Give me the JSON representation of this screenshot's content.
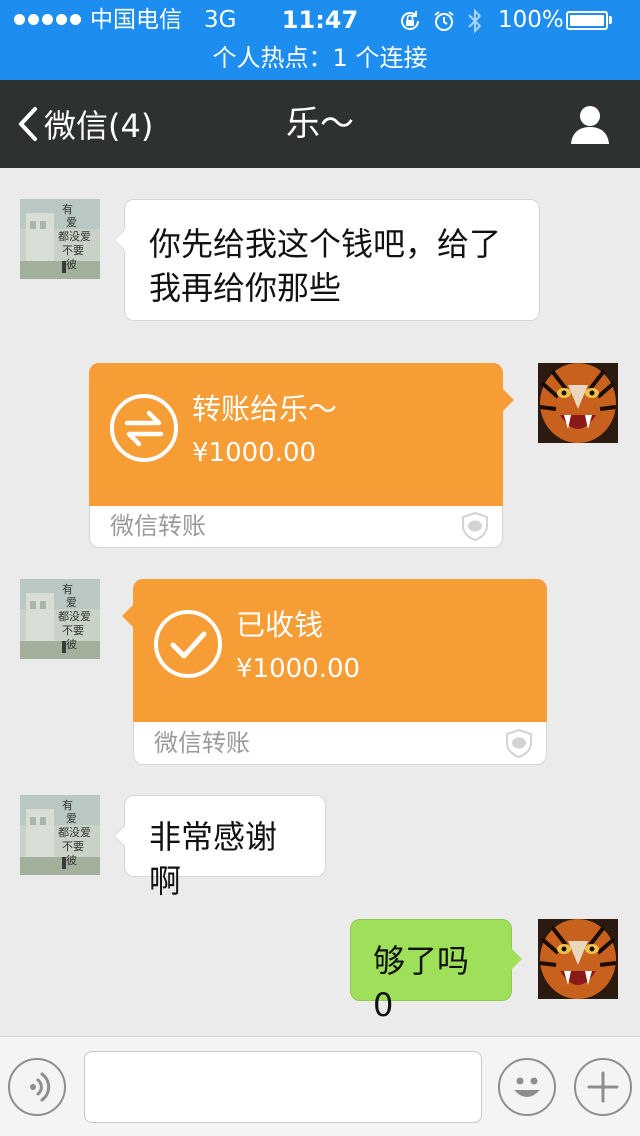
{
  "status_bar": {
    "carrier": "中国电信",
    "network": "3G",
    "time": "11:47",
    "battery": "100%",
    "hotspot": "个人热点：1 个连接",
    "color": "#1d8ef0"
  },
  "nav": {
    "back_label": "微信(4)",
    "title": "乐～",
    "color": "#2e3132"
  },
  "messages": [
    {
      "side": "left",
      "type": "text",
      "lines": [
        "你先给我这个钱吧，给了",
        "我再给你那些"
      ]
    },
    {
      "side": "right",
      "type": "transfer",
      "title": "转账给乐～",
      "amount": "¥1000.00",
      "footer": "微信转账",
      "icon": "transfer-arrows-icon"
    },
    {
      "side": "left",
      "type": "transfer",
      "title": "已收钱",
      "amount": "¥1000.00",
      "footer": "微信转账",
      "icon": "checkmark-icon"
    },
    {
      "side": "left",
      "type": "text",
      "lines": [
        "非常感谢啊"
      ]
    },
    {
      "side": "right",
      "type": "text",
      "lines": [
        "够了吗0"
      ]
    }
  ],
  "avatar_left_text": [
    "有",
    "爱",
    "都没爱",
    "不要",
    "彼"
  ],
  "input_bar": {
    "voice_icon": "voice-icon",
    "emoji_icon": "emoji-icon",
    "plus_icon": "plus-icon",
    "value": ""
  },
  "colors": {
    "transfer_orange": "#f79d35",
    "sent_green": "#9fe05a",
    "chat_bg": "#ebebeb"
  }
}
